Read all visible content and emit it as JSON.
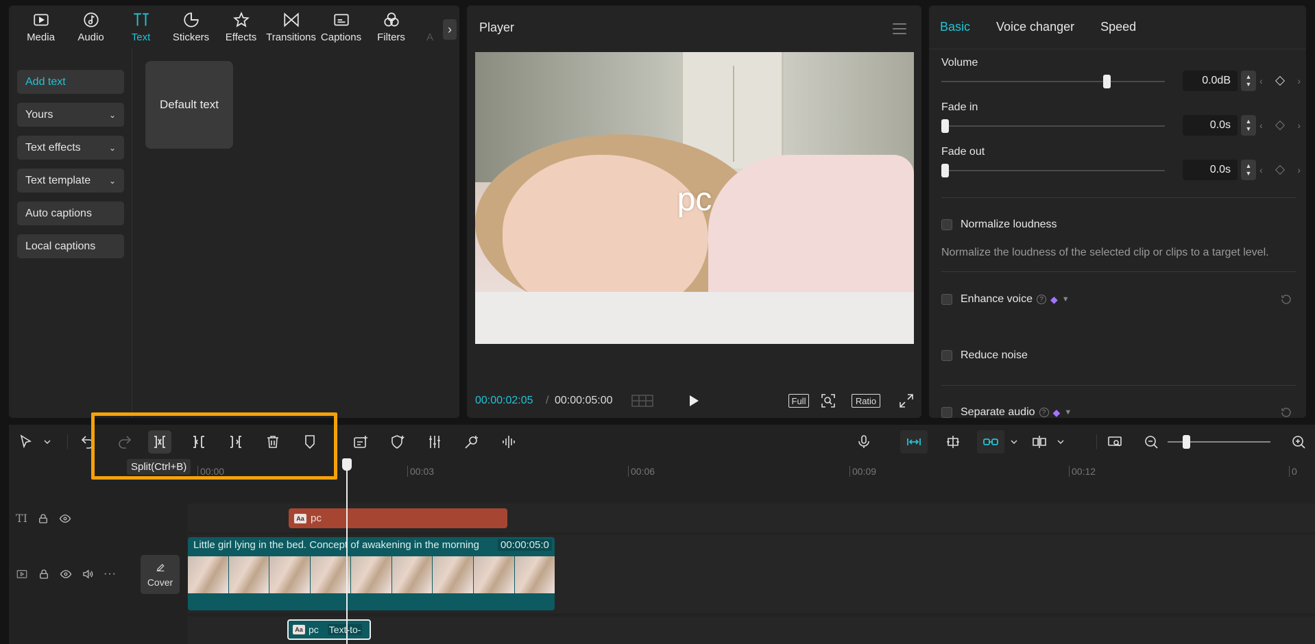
{
  "tabs": [
    {
      "label": "Media",
      "icon": "media-icon"
    },
    {
      "label": "Audio",
      "icon": "audio-icon"
    },
    {
      "label": "Text",
      "icon": "text-icon"
    },
    {
      "label": "Stickers",
      "icon": "stickers-icon"
    },
    {
      "label": "Effects",
      "icon": "effects-icon"
    },
    {
      "label": "Transitions",
      "icon": "transitions-icon"
    },
    {
      "label": "Captions",
      "icon": "captions-icon"
    },
    {
      "label": "Filters",
      "icon": "filters-icon"
    },
    {
      "label": "A",
      "icon": "more-tab"
    }
  ],
  "active_tab": "Text",
  "sidebar": {
    "items": [
      {
        "label": "Add text",
        "has_dropdown": false
      },
      {
        "label": "Yours",
        "has_dropdown": true
      },
      {
        "label": "Text effects",
        "has_dropdown": true
      },
      {
        "label": "Text template",
        "has_dropdown": true
      },
      {
        "label": "Auto captions",
        "has_dropdown": false
      },
      {
        "label": "Local captions",
        "has_dropdown": false
      }
    ]
  },
  "text_card": {
    "label": "Default text"
  },
  "player": {
    "title": "Player",
    "overlay_text": "pc",
    "current_time": "00:00:02:05",
    "separator": "/",
    "total_time": "00:00:05:00",
    "full_label": "Full",
    "ratio_label": "Ratio"
  },
  "right_panel": {
    "tabs": [
      "Basic",
      "Voice changer",
      "Speed"
    ],
    "volume": {
      "label": "Volume",
      "value": "0.0dB",
      "level": 0.75
    },
    "fade_in": {
      "label": "Fade in",
      "value": "0.0s",
      "level": 0
    },
    "fade_out": {
      "label": "Fade out",
      "value": "0.0s",
      "level": 0
    },
    "normalize": {
      "label": "Normalize loudness",
      "note": "Normalize the loudness of the selected clip or clips to a target level.",
      "checked": false
    },
    "enhance": {
      "label": "Enhance voice",
      "checked": false
    },
    "reduce": {
      "label": "Reduce noise",
      "checked": false
    },
    "separate": {
      "label": "Separate audio",
      "checked": false
    }
  },
  "timeline": {
    "tooltip": "Split(Ctrl+B)",
    "ruler": [
      "00:00",
      "00:03",
      "00:06",
      "00:09",
      "00:12",
      "0"
    ],
    "text_clip": {
      "tag": "Aa",
      "label": "pc"
    },
    "video_clip": {
      "label": "Little girl lying in the bed. Concept of awakening in the morning",
      "duration": "00:00:05:0"
    },
    "cover_label": "Cover",
    "tts_clip": {
      "tag": "Aa",
      "label": "pc",
      "label2": "Text-to-"
    },
    "zoom_level": 0.15
  },
  "colors": {
    "accent": "#22c3d6",
    "highlight": "#f5a20a",
    "text_clip": "#a64632",
    "video_clip": "#0d5a60"
  }
}
